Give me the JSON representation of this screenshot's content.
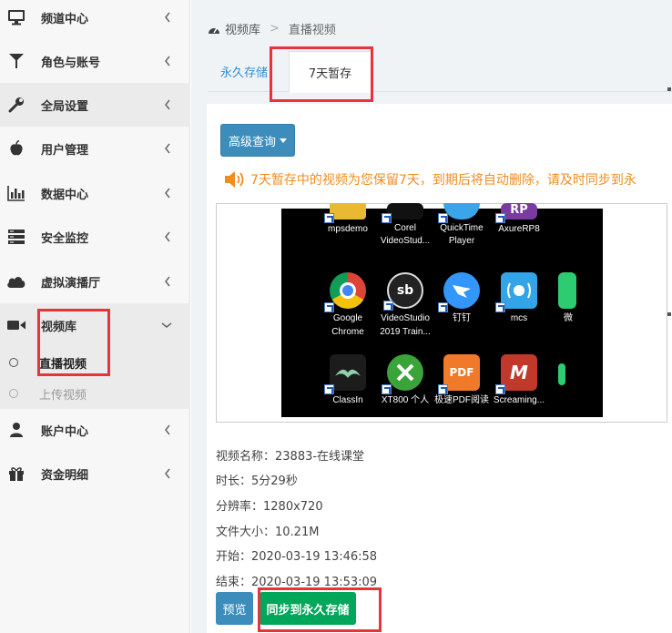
{
  "sidebar": {
    "items": [
      {
        "label": "频道中心",
        "icon": "monitor-icon"
      },
      {
        "label": "角色与账号",
        "icon": "filter-icon"
      },
      {
        "label": "全局设置",
        "icon": "wrench-icon"
      },
      {
        "label": "用户管理",
        "icon": "apple-icon"
      },
      {
        "label": "数据中心",
        "icon": "bar-chart-icon"
      },
      {
        "label": "安全监控",
        "icon": "server-icon"
      },
      {
        "label": "虚拟演播厅",
        "icon": "cloud-icon"
      },
      {
        "label": "视频库",
        "icon": "video-camera-icon"
      },
      {
        "label": "账户中心",
        "icon": "user-icon"
      },
      {
        "label": "资金明细",
        "icon": "gift-icon"
      }
    ],
    "sub_items": [
      {
        "label": "直播视频"
      },
      {
        "label": "上传视频"
      }
    ]
  },
  "breadcrumb": {
    "root": "视频库",
    "sep": ">",
    "current": "直播视频"
  },
  "tabs": [
    {
      "label": "永久存储"
    },
    {
      "label": "7天暂存"
    }
  ],
  "toolbar": {
    "advanced_query_label": "高级查询"
  },
  "notice": {
    "text": "7天暂存中的视频为您保留7天，到期后将自动删除，请及时同步到永"
  },
  "video_thumbnail": {
    "apps": [
      {
        "label": "mpsdemo"
      },
      {
        "label": "Corel\nVideoStud..."
      },
      {
        "label": "QuickTime\nPlayer"
      },
      {
        "label": "AxureRP8"
      },
      {
        "label": "Google\nChrome"
      },
      {
        "label": "VideoStudio\n2019 Train..."
      },
      {
        "label": "钉钉"
      },
      {
        "label": "mcs"
      },
      {
        "label": "微"
      },
      {
        "label": "ClassIn"
      },
      {
        "label": "XT800 个人"
      },
      {
        "label": "极速PDF阅读"
      },
      {
        "label": "Screaming..."
      }
    ]
  },
  "info": {
    "name": "视频名称：23883-在线课堂",
    "duration": "时长：5分29秒",
    "resolution": "分辨率：1280x720",
    "size": "文件大小：10.21M",
    "start": "开始：2020-03-19 13:46:58",
    "end": "结束：2020-03-19 13:53:09"
  },
  "actions": {
    "preview_label": "预览",
    "sync_label": "同步到永久存储"
  },
  "colors": {
    "accent_blue": "#3c8dbc",
    "sync_green": "#00a65a",
    "notice_orange": "#f08c20",
    "highlight_red": "#e8323c"
  }
}
